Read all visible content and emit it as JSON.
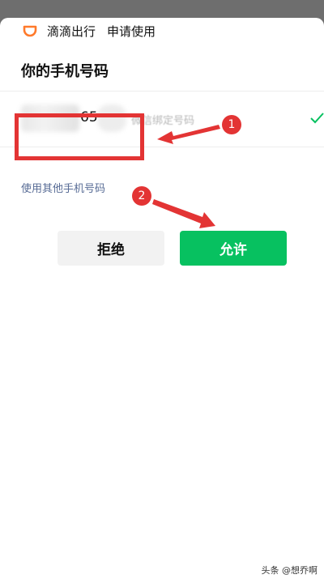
{
  "header": {
    "app_name": "滴滴出行",
    "request_label": "申请使用",
    "logo_icon": "didi-logo-icon",
    "logo_color": "#ff7a2b"
  },
  "title": "你的手机号码",
  "phone": {
    "digits_visible": "65",
    "source_label": "微信绑定号码",
    "selected_icon": "check-icon",
    "check_color": "#07c160"
  },
  "links": {
    "other_number": "使用其他手机号码"
  },
  "buttons": {
    "deny_label": "拒绝",
    "allow_label": "允许",
    "allow_color": "#07c160"
  },
  "annotations": {
    "badge_1": "1",
    "badge_2": "2",
    "color": "#e33434"
  },
  "watermark": "头条 @想乔啊"
}
